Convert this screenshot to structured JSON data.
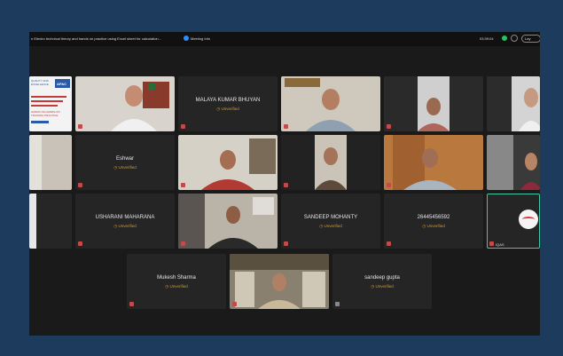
{
  "window": {
    "meeting_title": "n Electro technical theory and hands on practice using Excel sheet for calculation...",
    "meeting_info_label": "Meeting Info",
    "timer": "03:39:04",
    "view_label": "Lay"
  },
  "unverified_label": "Unverified",
  "participants": [
    {
      "name": "MALAYA KUMAR BHUYAN",
      "status": "Unverified"
    },
    {
      "name": "Eshwar",
      "status": "Unverified"
    },
    {
      "name": "USHARANI MAHARANA",
      "status": "Unverified"
    },
    {
      "name": "SANDEEP MOHANTY",
      "status": "Unverified"
    },
    {
      "name": "26445456592",
      "status": "Unverified"
    },
    {
      "name": "Mukesh Sharma",
      "status": "Unverified"
    },
    {
      "name": "sandeep gupta",
      "status": "Unverified"
    }
  ],
  "active_speaker_tag": "IQAS",
  "slide": {
    "header_left": "QUALITY AND EXCELLENCE",
    "header_logo": "APAC",
    "body_text": "HANDS ON HANDS-ON TRAINING PRACTICE"
  },
  "colors": {
    "frame_bg": "#1a1a1a",
    "tile_bg": "#252525",
    "outer_bg": "#1d3b5c",
    "unverified": "#d59a2a",
    "active_border": "#3ec8a6"
  }
}
